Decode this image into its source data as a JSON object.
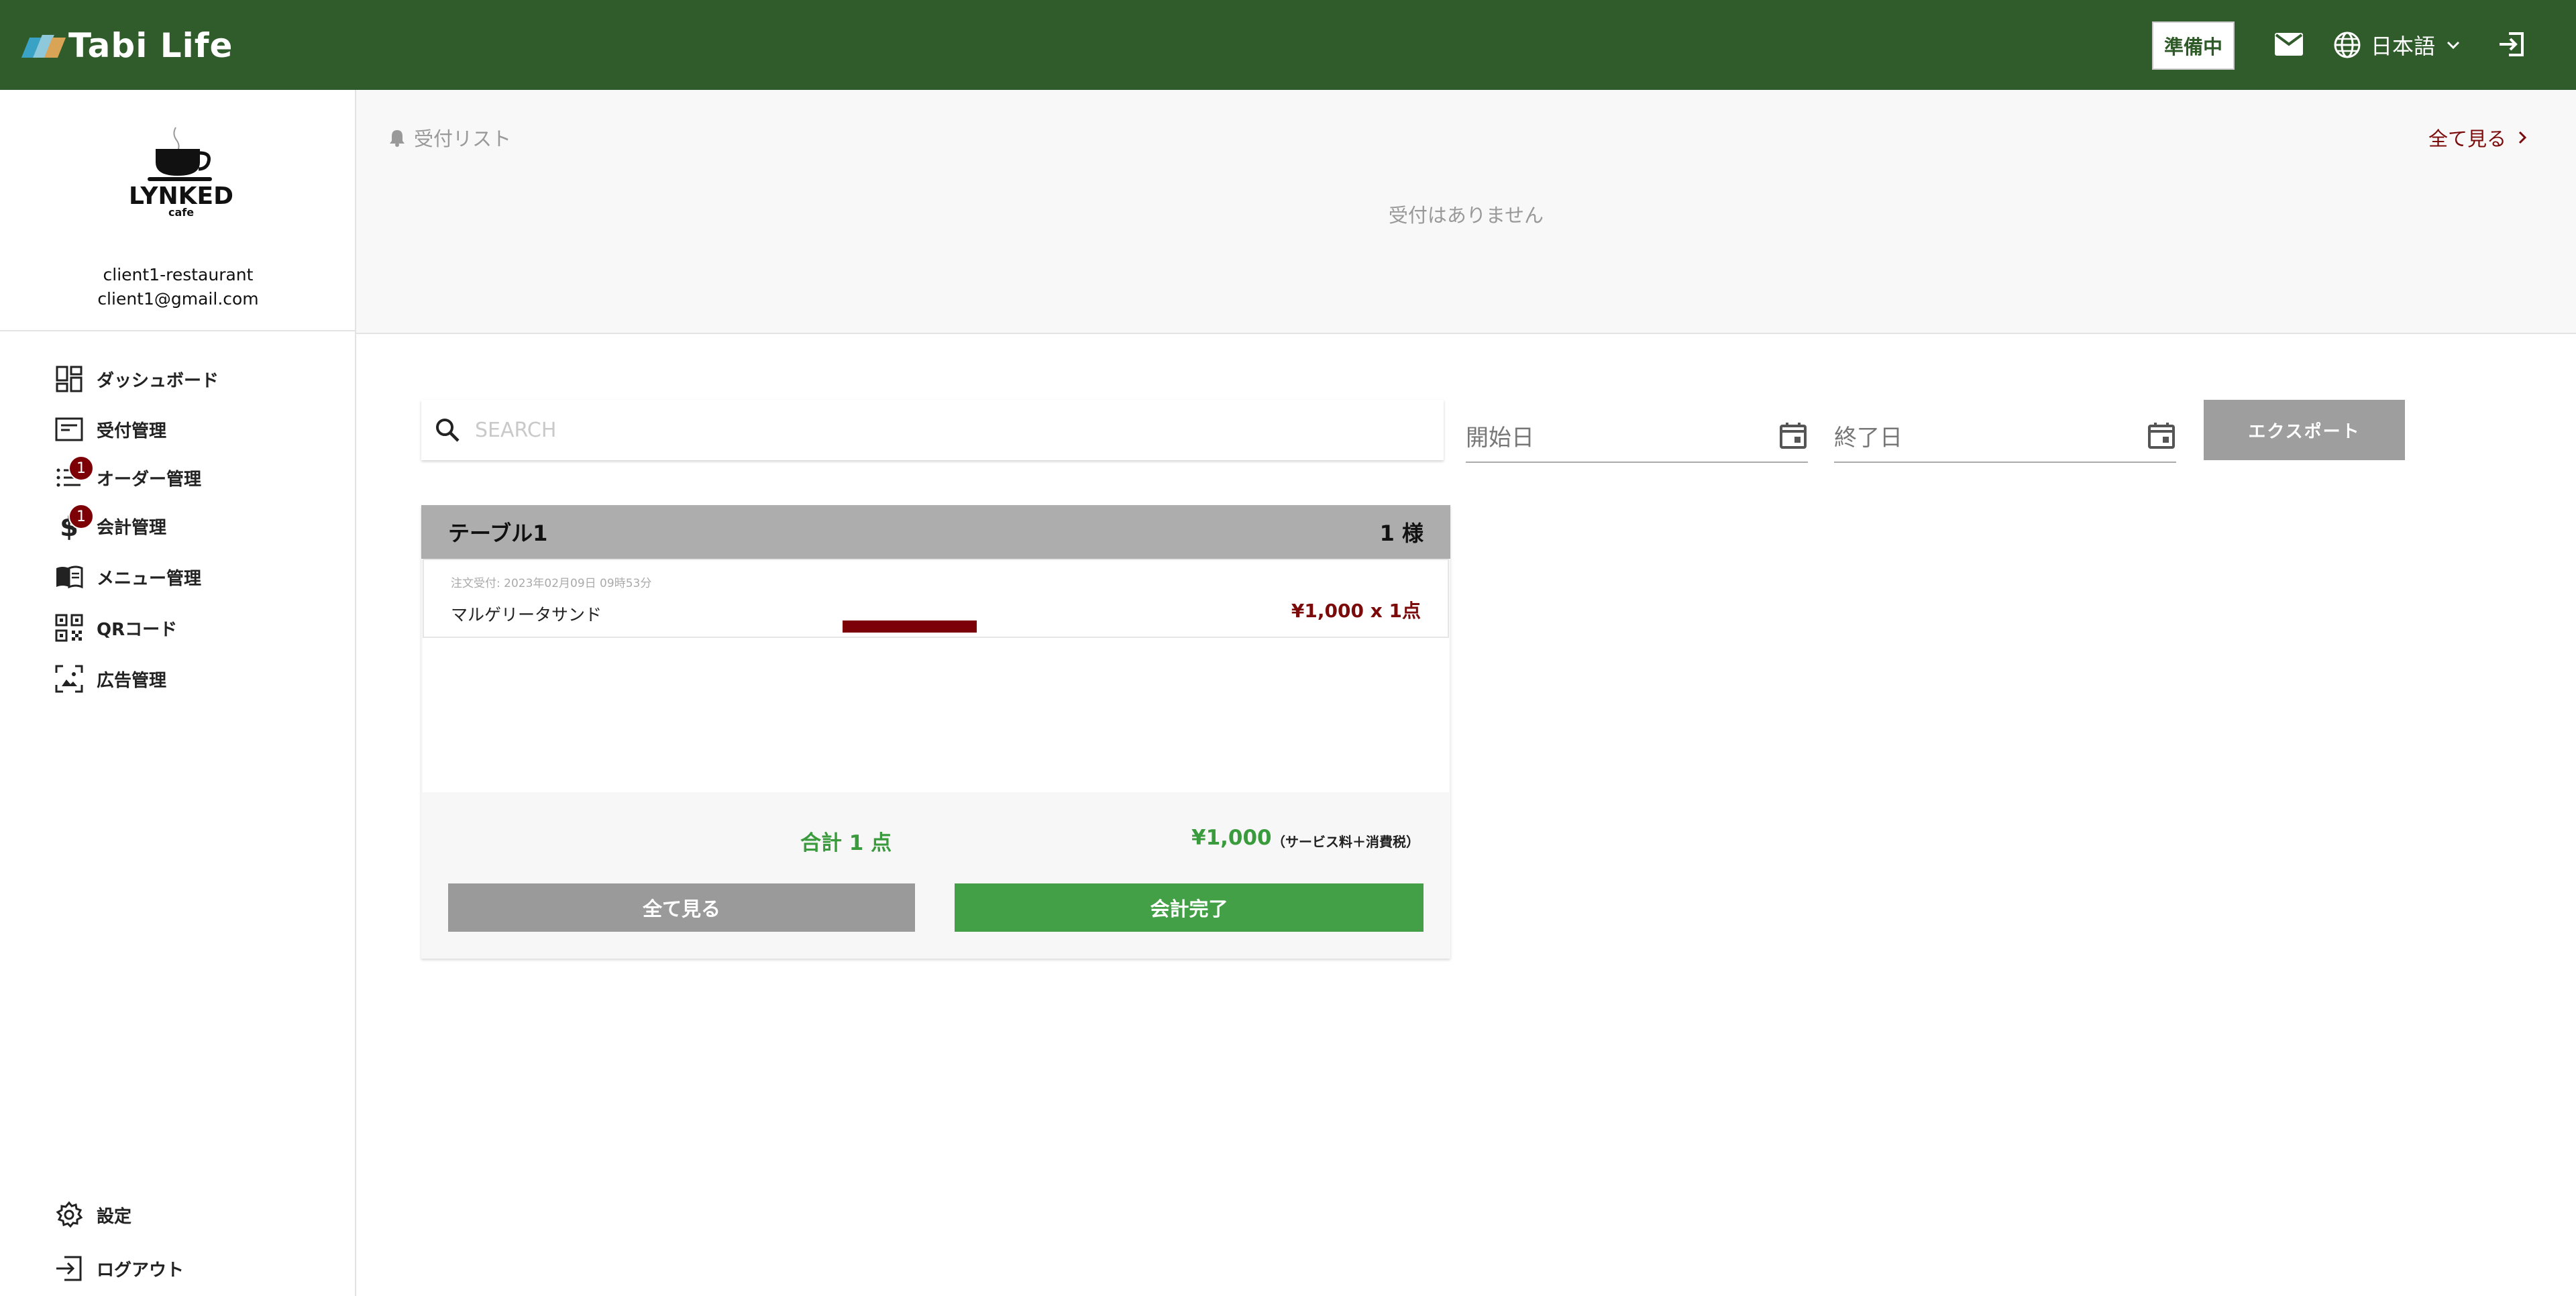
{
  "header": {
    "brand": "Tabi Life",
    "status_button": "準備中",
    "language": "日本語"
  },
  "sidebar": {
    "logo_name": "LYNKED",
    "logo_sub": "cafe",
    "account_name": "client1-restaurant",
    "account_email": "client1@gmail.com",
    "items": [
      {
        "label": "ダッシュボード",
        "icon": "dashboard-icon"
      },
      {
        "label": "受付管理",
        "icon": "reception-icon"
      },
      {
        "label": "オーダー管理",
        "icon": "list-icon",
        "badge": "1"
      },
      {
        "label": "会計管理",
        "icon": "dollar-icon",
        "badge": "1"
      },
      {
        "label": "メニュー管理",
        "icon": "menu-book-icon"
      },
      {
        "label": "QRコード",
        "icon": "qr-code-icon"
      },
      {
        "label": "広告管理",
        "icon": "image-icon"
      }
    ],
    "bottom_items": [
      {
        "label": "設定",
        "icon": "gear-icon"
      },
      {
        "label": "ログアウト",
        "icon": "logout-icon"
      }
    ]
  },
  "reception": {
    "title": "受付リスト",
    "view_all": "全て見る",
    "empty": "受付はありません"
  },
  "filters": {
    "search_placeholder": "SEARCH",
    "start_date": "開始日",
    "end_date": "終了日",
    "export": "エクスポート"
  },
  "card": {
    "table": "テーブル1",
    "guests": "1 様",
    "order_time": "注文受付: 2023年02月09日 09時53分",
    "item_name": "マルゲリータサンド",
    "item_price": "¥1,000 x 1点",
    "total_count": "合計 1 点",
    "total_price": "¥1,000",
    "total_note": "（サービス料＋消費税）",
    "view_all": "全て見る",
    "complete": "会計完了"
  },
  "colors": {
    "header": "#305b2b",
    "accent_red": "#7b0b0b",
    "green": "#43a047"
  }
}
